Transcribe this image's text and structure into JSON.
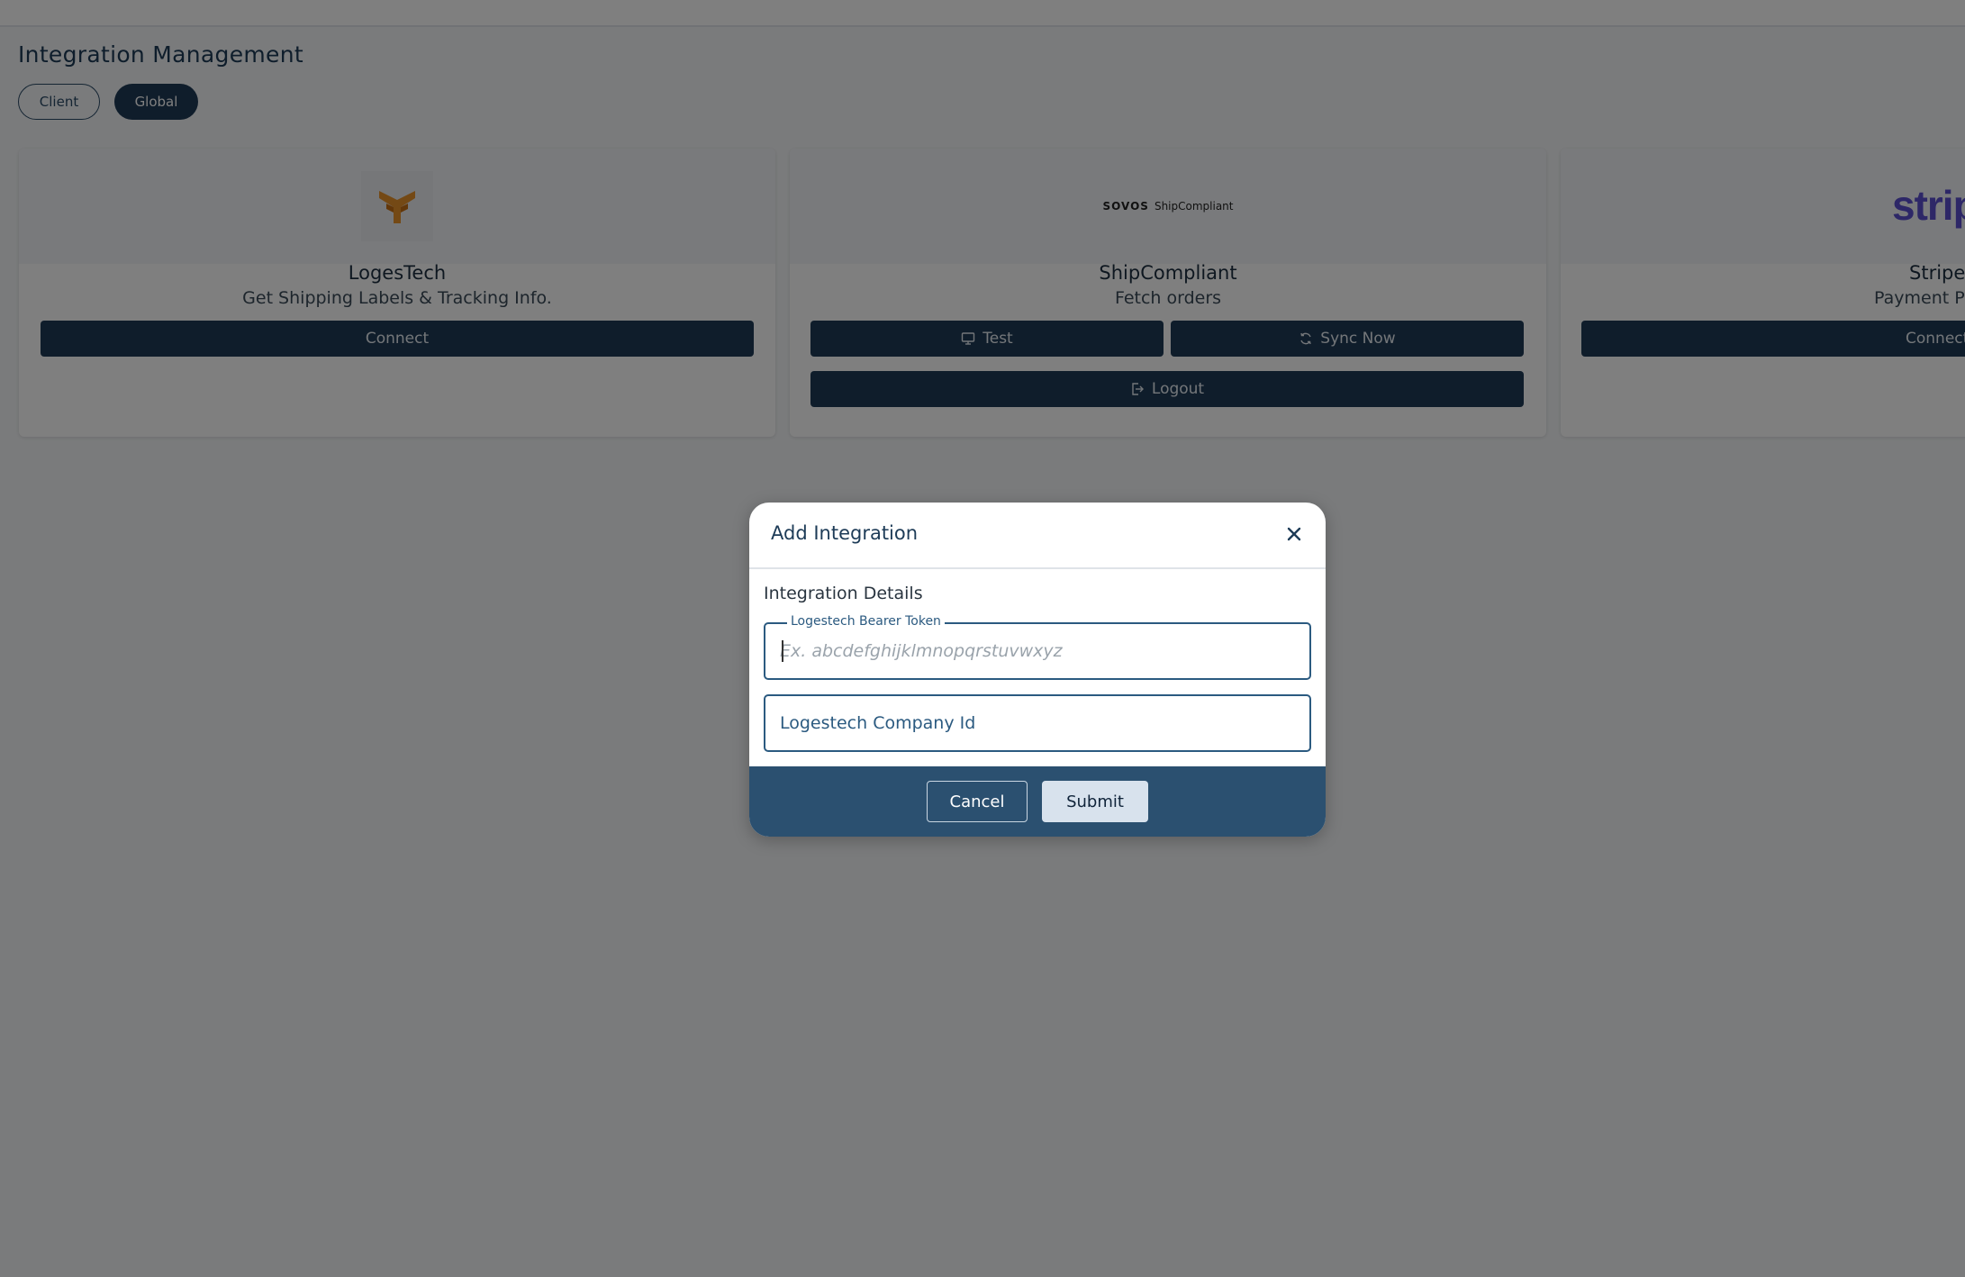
{
  "page": {
    "title": "Integration Management",
    "tabs": [
      {
        "label": "Client",
        "active": false
      },
      {
        "label": "Global",
        "active": true
      }
    ]
  },
  "cards": [
    {
      "name": "LogesTech",
      "description": "Get Shipping Labels & Tracking Info.",
      "logo": "logestech-logo",
      "buttons": {
        "connect": "Connect"
      }
    },
    {
      "name": "ShipCompliant",
      "description": "Fetch orders",
      "logo": {
        "brand": "SOVOS",
        "product": "ShipCompliant"
      },
      "buttons": {
        "test": "Test",
        "sync": "Sync Now",
        "logout": "Logout"
      }
    },
    {
      "name": "Stripe",
      "description": "Payment Pr",
      "logo": {
        "text": "stripe"
      },
      "buttons": {
        "connect": "Connect"
      }
    }
  ],
  "modal": {
    "title": "Add Integration",
    "section": "Integration Details",
    "fields": {
      "token": {
        "label": "Logestech Bearer Token",
        "placeholder": "Ex. abcdefghijklmnopqrstuvwxyz",
        "value": ""
      },
      "company": {
        "placeholder": "Logestech Company Id",
        "value": ""
      }
    },
    "buttons": {
      "cancel": "Cancel",
      "submit": "Submit"
    }
  },
  "colors": {
    "primary": "#1f3a56",
    "modal_footer": "#2b5070",
    "logestech_orange": "#e8922a",
    "stripe_purple": "#5a4fcf"
  }
}
